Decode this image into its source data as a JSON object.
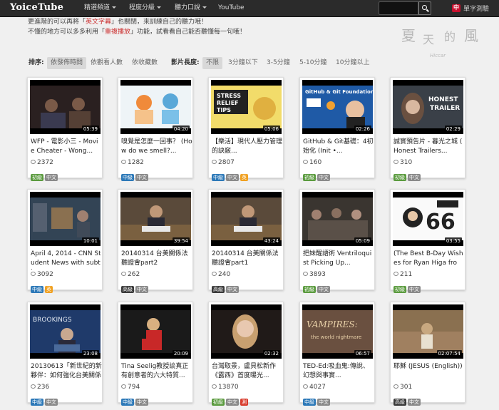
{
  "topbar": {
    "logo": "YoiceTube",
    "nav": [
      {
        "label": "精選頻道",
        "has_caret": true
      },
      {
        "label": "程度分級",
        "has_caret": true
      },
      {
        "label": "聽力口說",
        "has_caret": true
      },
      {
        "label": "YouTube",
        "has_caret": false
      }
    ],
    "search_placeholder": "",
    "lang_flag": "中",
    "lang_label": "單字測驗"
  },
  "notice": {
    "line1_a": "更進階的可以再將「",
    "line1_q": "英文字幕",
    "line1_b": "」也關閉，來訓練自己的聽力哦！",
    "line2_a": "不懂的地方可以多多利用「",
    "line2_q": "重複播放",
    "line2_b": "」功能，試看看自己能否聽懂每一句哦！"
  },
  "watermark": {
    "c1": "夏",
    "c2": "天",
    "c3": "的",
    "c4": "風",
    "sub": "Hiccar"
  },
  "filters": {
    "sort_label": "排序:",
    "sort_options": [
      "依發佈時間",
      "依觀看人數",
      "依收藏數"
    ],
    "sort_active": "依發佈時間",
    "length_label": "影片長度:",
    "length_options": [
      "不限",
      "3分鐘以下",
      "3-5分鐘",
      "5-10分鐘",
      "10分鐘以上"
    ],
    "length_active": "不限"
  },
  "cards": [
    {
      "title": "WFP - 電影小三 - Movie Cheater - Wong...",
      "duration": "05:39",
      "views": "2372",
      "tags": [
        {
          "t": "初級",
          "c": "basic"
        },
        {
          "t": "中文",
          "c": "zh"
        }
      ]
    },
    {
      "title": "嗅覺是怎麼一回事？ (How do we smell?...",
      "duration": "04:20",
      "views": "1282",
      "tags": [
        {
          "t": "中級",
          "c": "mid"
        },
        {
          "t": "中文",
          "c": "zh"
        }
      ]
    },
    {
      "title": "【樂活】現代人壓力管理的訣竅...",
      "duration": "05:06",
      "views": "2807",
      "tags": [
        {
          "t": "中級",
          "c": "mid"
        },
        {
          "t": "中文",
          "c": "zh"
        },
        {
          "t": "英",
          "c": "en"
        }
      ]
    },
    {
      "title": "GitHub & Git基礎：4初始化 (Init •...",
      "duration": "02:26",
      "views": "160",
      "tags": [
        {
          "t": "初級",
          "c": "basic"
        },
        {
          "t": "中文",
          "c": "zh"
        }
      ]
    },
    {
      "title": "誠實預告片 - 暮光之城 ( Honest Trailers...",
      "duration": "02:29",
      "views": "310",
      "tags": [
        {
          "t": "初級",
          "c": "basic"
        },
        {
          "t": "中文",
          "c": "zh"
        }
      ]
    },
    {
      "title": "April 4, 2014 - CNN Student News with subti",
      "duration": "10:01",
      "views": "3092",
      "tags": [
        {
          "t": "中級",
          "c": "mid"
        },
        {
          "t": "英",
          "c": "en"
        }
      ]
    },
    {
      "title": "20140314 台美關係法聽證會part2",
      "duration": "39:54",
      "views": "262",
      "tags": [
        {
          "t": "高級",
          "c": "high"
        },
        {
          "t": "中文",
          "c": "zh"
        }
      ]
    },
    {
      "title": "20140314 台美關係法聽證會part1",
      "duration": "43:24",
      "views": "240",
      "tags": [
        {
          "t": "高級",
          "c": "high"
        },
        {
          "t": "中文",
          "c": "zh"
        }
      ]
    },
    {
      "title": "把妹醒語術 Ventriloquist Picking Up...",
      "duration": "05:09",
      "views": "3893",
      "tags": [
        {
          "t": "初級",
          "c": "basic"
        },
        {
          "t": "中文",
          "c": "zh"
        }
      ]
    },
    {
      "title": "(The Best B-Day Wishes for Ryan Higa from...",
      "duration": "03:55",
      "views": "211",
      "tags": [
        {
          "t": "初級",
          "c": "basic"
        },
        {
          "t": "中文",
          "c": "zh"
        }
      ]
    },
    {
      "title": "20130613「新世紀的新夥伴：如何強化台美關係",
      "duration": "23:08",
      "views": "236",
      "tags": [
        {
          "t": "中級",
          "c": "mid"
        },
        {
          "t": "中文",
          "c": "zh"
        }
      ]
    },
    {
      "title": "Tina Seelig教授談真正有創意者的六大特質...",
      "duration": "20:09",
      "views": "794",
      "tags": [
        {
          "t": "中級",
          "c": "mid"
        },
        {
          "t": "中文",
          "c": "zh"
        }
      ]
    },
    {
      "title": "台灣取景，盧貝松新作《露西》首度曝光...",
      "duration": "02:32",
      "views": "13870",
      "tags": [
        {
          "t": "初級",
          "c": "basic"
        },
        {
          "t": "中文",
          "c": "zh"
        },
        {
          "t": "測",
          "c": "ja"
        }
      ]
    },
    {
      "title": "TED-Ed:吸血鬼:傳說、幻想與事實...",
      "duration": "06:57",
      "views": "4027",
      "tags": [
        {
          "t": "中級",
          "c": "mid"
        },
        {
          "t": "中文",
          "c": "zh"
        }
      ]
    },
    {
      "title": "耶穌 (JESUS (English))",
      "duration": "02:07:54",
      "views": "301",
      "tags": [
        {
          "t": "高級",
          "c": "high"
        },
        {
          "t": "中文",
          "c": "zh"
        }
      ]
    }
  ]
}
